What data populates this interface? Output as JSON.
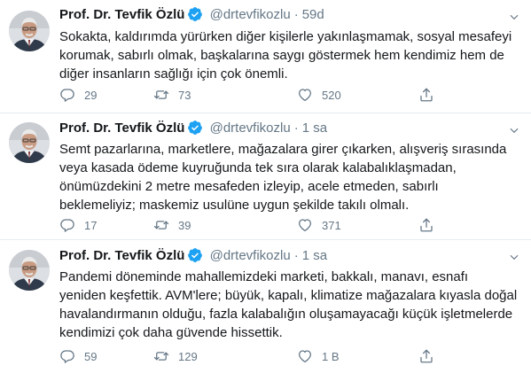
{
  "tweets": [
    {
      "name": "Prof. Dr. Tevfik Özlü",
      "handle": "@drtevfikozlu",
      "time": "59d",
      "lines": [
        "Sokakta, kaldırımda yürürken diğer kişilerle yakınlaşmamak, sosyal mesafeyi",
        "korumak, sabırlı olmak, başkalarına saygı göstermek hem kendimiz hem de",
        "diğer insanların sağlığı için çok önemli."
      ],
      "replies": "29",
      "retweets": "73",
      "likes": "520"
    },
    {
      "name": "Prof. Dr. Tevfik Özlü",
      "handle": "@drtevfikozlu",
      "time": "1 sa",
      "lines": [
        "Semt pazarlarına, marketlere, mağazalara girer çıkarken, alışveriş sırasında",
        "veya kasada ödeme kuyruğunda tek sıra olarak kalabalıklaşmadan,",
        "önümüzdekini 2 metre mesafeden izleyip, acele etmeden, sabırlı",
        "beklemeliyiz; maskemiz usulüne uygun şekilde takılı olmalı."
      ],
      "replies": "17",
      "retweets": "39",
      "likes": "371"
    },
    {
      "name": "Prof. Dr. Tevfik Özlü",
      "handle": "@drtevfikozlu",
      "time": "1 sa",
      "lines": [
        "Pandemi döneminde mahallemizdeki marketi, bakkalı, manavı, esnafı",
        "yeniden keşfettik. AVM'lere; büyük, kapalı, klimatize mağazalara kıyasla doğal",
        "havalandırmanın olduğu, fazla kalabalığın oluşamayacağı küçük  işletmelerde",
        "kendimizi çok daha güvende hissettik."
      ],
      "replies": "59",
      "retweets": "129",
      "likes": "1 B"
    }
  ],
  "icons": {
    "verified": "verified-badge-icon",
    "caret": "chevron-down-icon",
    "reply": "reply-icon",
    "retweet": "retweet-icon",
    "like": "heart-icon",
    "share": "share-icon"
  },
  "colors": {
    "text": "#14171a",
    "muted": "#657786",
    "verified": "#1da1f2",
    "divider": "#e6ecf0"
  }
}
